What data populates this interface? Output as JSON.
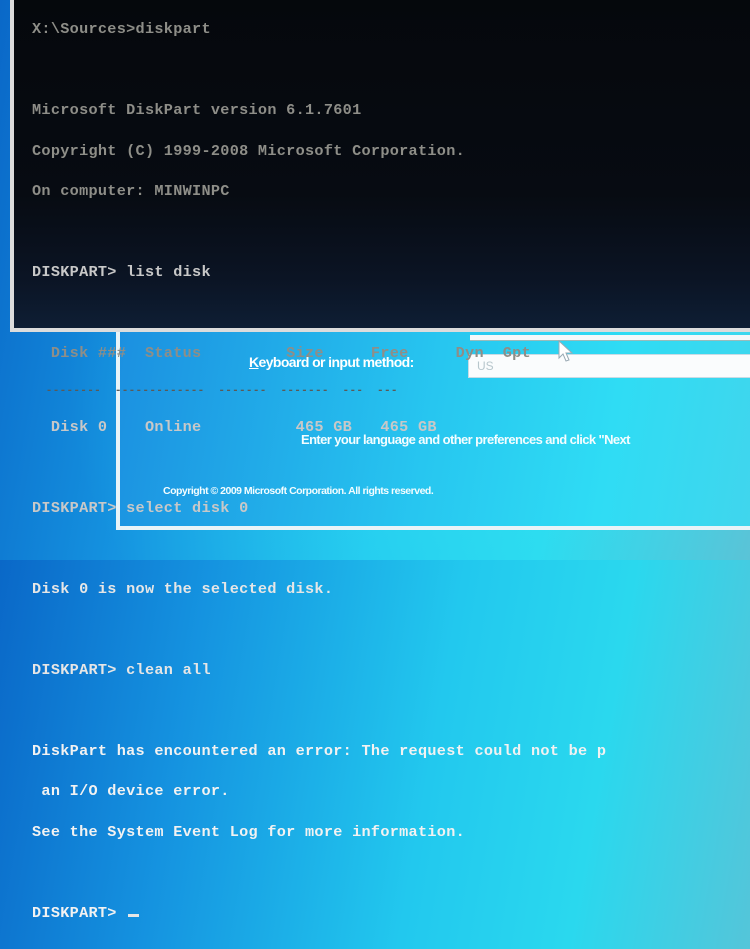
{
  "setup": {
    "keyboard_label_accel": "K",
    "keyboard_label_rest": "eyboard or input method:",
    "keyboard_value": "US",
    "instructions": "Enter your language and other preferences and click \"Next",
    "copyright": "Copyright © 2009 Microsoft Corporation. All rights reserved."
  },
  "console": {
    "lines": {
      "prompt_path": "X:\\Sources>diskpart",
      "version": "Microsoft DiskPart version 6.1.7601",
      "copyright": "Copyright (C) 1999-2008 Microsoft Corporation.",
      "computer": "On computer: MINWINPC",
      "cmd_list": "DISKPART> list disk",
      "table_header": "  Disk ###  Status         Size     Free     Dyn  Gpt",
      "table_sep": "  --------  -------------  -------  -------  ---  ---",
      "table_row": "  Disk 0    Online          465 GB   465 GB",
      "cmd_select": "DISKPART> select disk 0",
      "select_result": "Disk 0 is now the selected disk.",
      "cmd_clean": "DISKPART> clean all",
      "error_1": "DiskPart has encountered an error: The request could not be p",
      "error_2": " an I/O device error.",
      "error_3": "See the System Event Log for more information.",
      "prompt": "DISKPART> "
    },
    "disk_table": {
      "columns": [
        "Disk ###",
        "Status",
        "Size",
        "Free",
        "Dyn",
        "Gpt"
      ],
      "rows": [
        {
          "disk": "Disk 0",
          "status": "Online",
          "size": "465 GB",
          "free": "465 GB",
          "dyn": "",
          "gpt": ""
        }
      ]
    }
  },
  "colors": {
    "console_bg": "#05080c",
    "console_text": "#c8c8c8",
    "desktop_blue": "#1593e0",
    "setup_cyan": "#2fdcf4"
  }
}
